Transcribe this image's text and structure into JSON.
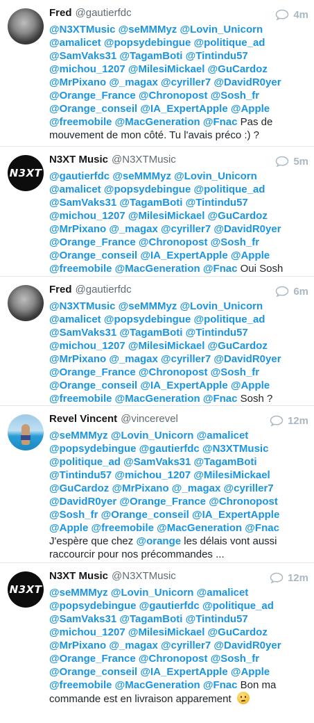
{
  "tweets": [
    {
      "name": "Fred",
      "handle": "@gautierfdc",
      "time": "4m",
      "avatar": "fred-avatar",
      "lines": [
        [
          {
            "m": "@N3XTMusic"
          },
          {
            "m": "@seMMMyz"
          },
          {
            "m": "@Lovin_Unicorn"
          }
        ],
        [
          {
            "m": "@amalicet"
          },
          {
            "m": "@popsydebingue"
          },
          {
            "m": "@politique_ad"
          }
        ],
        [
          {
            "m": "@SamVaks31"
          },
          {
            "m": "@TagamBoti"
          },
          {
            "m": "@Tintindu57"
          }
        ],
        [
          {
            "m": "@michou_1207"
          },
          {
            "m": "@MilesiMickael"
          },
          {
            "m": "@GuCardoz"
          }
        ],
        [
          {
            "m": "@MrPixano"
          },
          {
            "m": "@_magax"
          },
          {
            "m": "@cyriller7"
          },
          {
            "m": "@DavidR0yer"
          }
        ],
        [
          {
            "m": "@Orange_France"
          },
          {
            "m": "@Chronopost"
          },
          {
            "m": "@Sosh_fr"
          }
        ],
        [
          {
            "m": "@Orange_conseil"
          },
          {
            "m": "@IA_ExpertApple"
          },
          {
            "m": "@Apple"
          }
        ],
        [
          {
            "m": "@freemobile"
          },
          {
            "m": "@MacGeneration"
          },
          {
            "m": "@Fnac"
          },
          {
            "t": "Pas de"
          }
        ],
        [
          {
            "t": "mouvement de mon côté. Tu l'avais préco :) ?"
          }
        ]
      ]
    },
    {
      "name": "N3XT Music",
      "handle": "@N3XTMusic",
      "time": "5m",
      "avatar": "n3xt-avatar",
      "avatar_text": "N3XT",
      "lines": [
        [
          {
            "m": "@gautierfdc"
          },
          {
            "m": "@seMMMyz"
          },
          {
            "m": "@Lovin_Unicorn"
          }
        ],
        [
          {
            "m": "@amalicet"
          },
          {
            "m": "@popsydebingue"
          },
          {
            "m": "@politique_ad"
          }
        ],
        [
          {
            "m": "@SamVaks31"
          },
          {
            "m": "@TagamBoti"
          },
          {
            "m": "@Tintindu57"
          }
        ],
        [
          {
            "m": "@michou_1207"
          },
          {
            "m": "@MilesiMickael"
          },
          {
            "m": "@GuCardoz"
          }
        ],
        [
          {
            "m": "@MrPixano"
          },
          {
            "m": "@_magax"
          },
          {
            "m": "@cyriller7"
          },
          {
            "m": "@DavidR0yer"
          }
        ],
        [
          {
            "m": "@Orange_France"
          },
          {
            "m": "@Chronopost"
          },
          {
            "m": "@Sosh_fr"
          }
        ],
        [
          {
            "m": "@Orange_conseil"
          },
          {
            "m": "@IA_ExpertApple"
          },
          {
            "m": "@Apple"
          }
        ],
        [
          {
            "m": "@freemobile"
          },
          {
            "m": "@MacGeneration"
          },
          {
            "m": "@Fnac"
          },
          {
            "t": "Oui Sosh"
          }
        ]
      ]
    },
    {
      "name": "Fred",
      "handle": "@gautierfdc",
      "time": "6m",
      "avatar": "fred-avatar",
      "lines": [
        [
          {
            "m": "@N3XTMusic"
          },
          {
            "m": "@seMMMyz"
          },
          {
            "m": "@Lovin_Unicorn"
          }
        ],
        [
          {
            "m": "@amalicet"
          },
          {
            "m": "@popsydebingue"
          },
          {
            "m": "@politique_ad"
          }
        ],
        [
          {
            "m": "@SamVaks31"
          },
          {
            "m": "@TagamBoti"
          },
          {
            "m": "@Tintindu57"
          }
        ],
        [
          {
            "m": "@michou_1207"
          },
          {
            "m": "@MilesiMickael"
          },
          {
            "m": "@GuCardoz"
          }
        ],
        [
          {
            "m": "@MrPixano"
          },
          {
            "m": "@_magax"
          },
          {
            "m": "@cyriller7"
          },
          {
            "m": "@DavidR0yer"
          }
        ],
        [
          {
            "m": "@Orange_France"
          },
          {
            "m": "@Chronopost"
          },
          {
            "m": "@Sosh_fr"
          }
        ],
        [
          {
            "m": "@Orange_conseil"
          },
          {
            "m": "@IA_ExpertApple"
          },
          {
            "m": "@Apple"
          }
        ],
        [
          {
            "m": "@freemobile"
          },
          {
            "m": "@MacGeneration"
          },
          {
            "m": "@Fnac"
          },
          {
            "t": "Sosh ?"
          }
        ]
      ]
    },
    {
      "name": "Revel Vincent",
      "handle": "@vincerevel",
      "time": "12m",
      "avatar": "revel-avatar",
      "lines": [
        [
          {
            "m": "@seMMMyz"
          },
          {
            "m": "@Lovin_Unicorn"
          },
          {
            "m": "@amalicet"
          }
        ],
        [
          {
            "m": "@popsydebingue"
          },
          {
            "m": "@gautierfdc"
          },
          {
            "m": "@N3XTMusic"
          }
        ],
        [
          {
            "m": "@politique_ad"
          },
          {
            "m": "@SamVaks31"
          },
          {
            "m": "@TagamBoti"
          }
        ],
        [
          {
            "m": "@Tintindu57"
          },
          {
            "m": "@michou_1207"
          },
          {
            "m": "@MilesiMickael"
          }
        ],
        [
          {
            "m": "@GuCardoz"
          },
          {
            "m": "@MrPixano"
          },
          {
            "m": "@_magax"
          },
          {
            "m": "@cyriller7"
          }
        ],
        [
          {
            "m": "@DavidR0yer"
          },
          {
            "m": "@Orange_France"
          },
          {
            "m": "@Chronopost"
          }
        ],
        [
          {
            "m": "@Sosh_fr"
          },
          {
            "m": "@Orange_conseil"
          },
          {
            "m": "@IA_ExpertApple"
          }
        ],
        [
          {
            "m": "@Apple"
          },
          {
            "m": "@freemobile"
          },
          {
            "m": "@MacGeneration"
          },
          {
            "m": "@Fnac"
          }
        ],
        [
          {
            "t": "J'espère que chez"
          },
          {
            "m": "@orange"
          },
          {
            "t": "les délais vont aussi"
          }
        ],
        [
          {
            "t": "raccourcir pour nos précommandes ..."
          }
        ]
      ]
    },
    {
      "name": "N3XT Music",
      "handle": "@N3XTMusic",
      "time": "12m",
      "avatar": "n3xt-avatar",
      "avatar_text": "N3XT",
      "lines": [
        [
          {
            "m": "@seMMMyz"
          },
          {
            "m": "@Lovin_Unicorn"
          },
          {
            "m": "@amalicet"
          }
        ],
        [
          {
            "m": "@popsydebingue"
          },
          {
            "m": "@gautierfdc"
          },
          {
            "m": "@politique_ad"
          }
        ],
        [
          {
            "m": "@SamVaks31"
          },
          {
            "m": "@TagamBoti"
          },
          {
            "m": "@Tintindu57"
          }
        ],
        [
          {
            "m": "@michou_1207"
          },
          {
            "m": "@MilesiMickael"
          },
          {
            "m": "@GuCardoz"
          }
        ],
        [
          {
            "m": "@MrPixano"
          },
          {
            "m": "@_magax"
          },
          {
            "m": "@cyriller7"
          },
          {
            "m": "@DavidR0yer"
          }
        ],
        [
          {
            "m": "@Orange_France"
          },
          {
            "m": "@Chronopost"
          },
          {
            "m": "@Sosh_fr"
          }
        ],
        [
          {
            "m": "@Orange_conseil"
          },
          {
            "m": "@IA_ExpertApple"
          },
          {
            "m": "@Apple"
          }
        ],
        [
          {
            "m": "@freemobile"
          },
          {
            "m": "@MacGeneration"
          },
          {
            "m": "@Fnac"
          },
          {
            "t": "Bon ma"
          }
        ],
        [
          {
            "t": "commande est en livraison apparement"
          },
          {
            "e": "thinking-face-emoji"
          }
        ]
      ]
    }
  ],
  "colors": {
    "mention": "#1b95e0",
    "name": "#14171a",
    "handle": "#5f6b75",
    "time": "#aab8c2",
    "divider": "#e1e8ed"
  },
  "icons": {
    "reply": "reply-icon"
  }
}
